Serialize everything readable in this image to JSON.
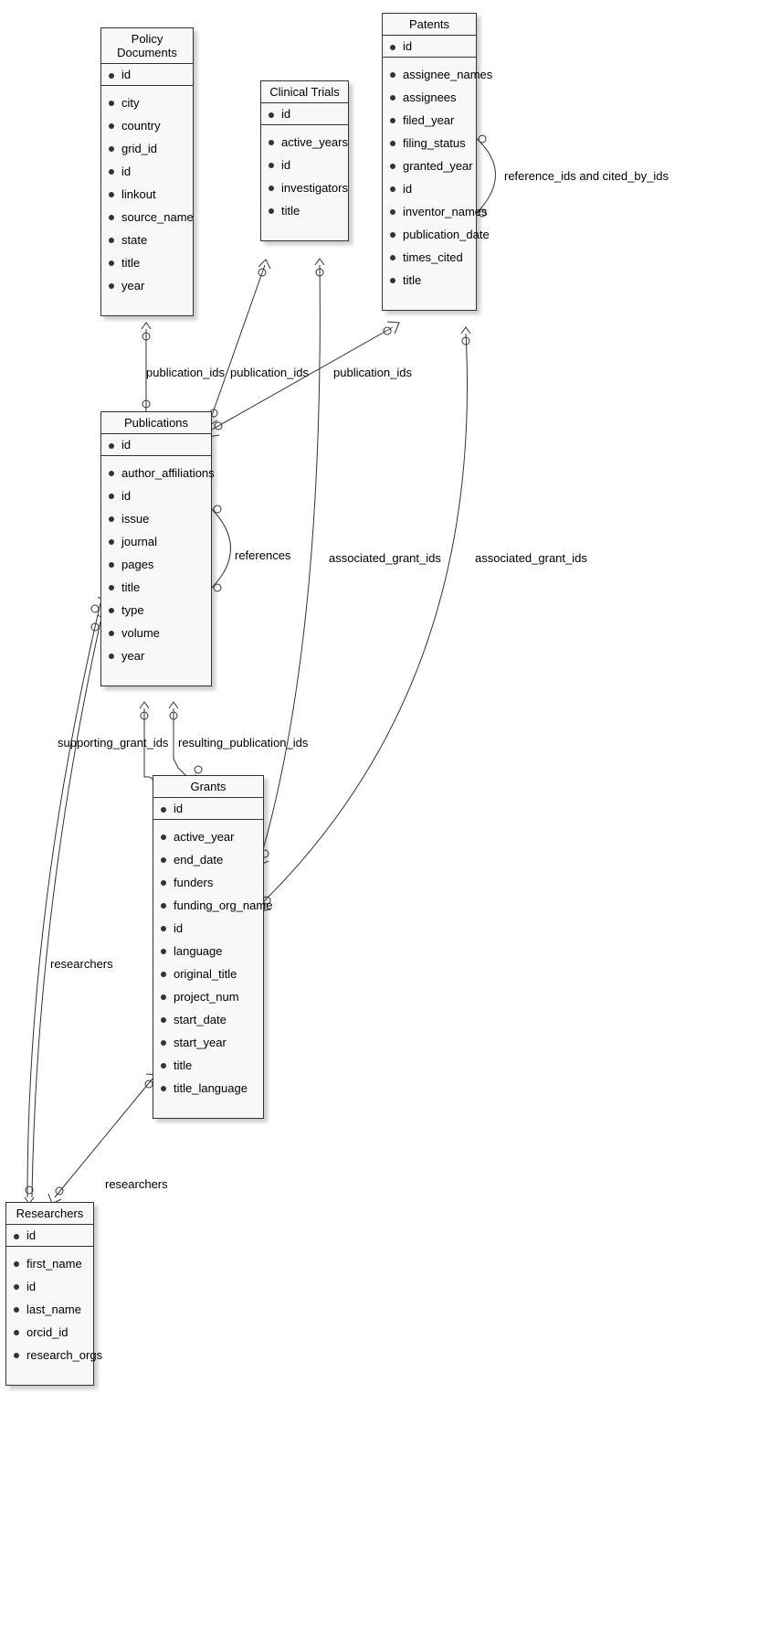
{
  "entities": {
    "policy_documents": {
      "title": "Policy Documents",
      "pk": "id",
      "attrs": [
        "city",
        "country",
        "grid_id",
        "id",
        "linkout",
        "source_name",
        "state",
        "title",
        "year"
      ]
    },
    "clinical_trials": {
      "title": "Clinical Trials",
      "pk": "id",
      "attrs": [
        "active_years",
        "id",
        "investigators",
        "title"
      ]
    },
    "patents": {
      "title": "Patents",
      "pk": "id",
      "attrs": [
        "assignee_names",
        "assignees",
        "filed_year",
        "filing_status",
        "granted_year",
        "id",
        "inventor_names",
        "publication_date",
        "times_cited",
        "title"
      ]
    },
    "publications": {
      "title": "Publications",
      "pk": "id",
      "attrs": [
        "author_affiliations",
        "id",
        "issue",
        "journal",
        "pages",
        "title",
        "type",
        "volume",
        "year"
      ]
    },
    "grants": {
      "title": "Grants",
      "pk": "id",
      "attrs": [
        "active_year",
        "end_date",
        "funders",
        "funding_org_name",
        "id",
        "language",
        "original_title",
        "project_num",
        "start_date",
        "start_year",
        "title",
        "title_language"
      ]
    },
    "researchers": {
      "title": "Researchers",
      "pk": "id",
      "attrs": [
        "first_name",
        "id",
        "last_name",
        "orcid_id",
        "research_orgs"
      ]
    }
  },
  "edges": {
    "policy_pub": "publication_ids",
    "clinical_pub": "publication_ids",
    "patents_pub": "publication_ids",
    "patents_self": "reference_ids and cited_by_ids",
    "pub_self": "references",
    "clinical_grants": "associated_grant_ids",
    "patents_grants": "associated_grant_ids",
    "pub_grants_supporting": "supporting_grant_ids",
    "pub_grants_resulting": "resulting_publication_ids",
    "pub_researchers": "researchers",
    "grants_researchers": "researchers"
  }
}
